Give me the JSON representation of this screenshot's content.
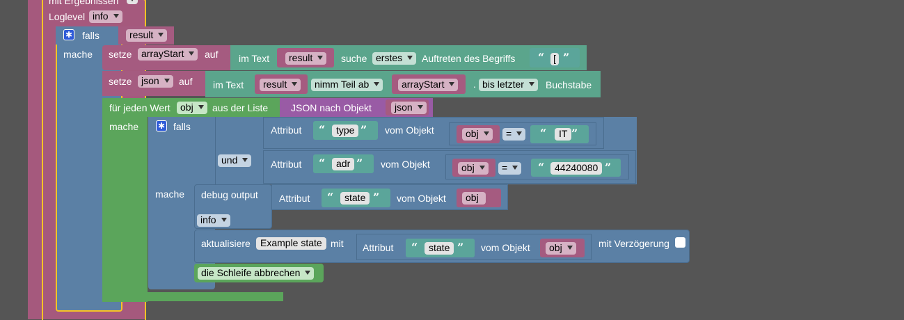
{
  "top": {
    "mit_ergebnissen_label": "mit Ergebnissen",
    "loglevel_label": "Loglevel",
    "loglevel_value": "info"
  },
  "outer_if": {
    "falls_label": "falls",
    "condition_var": "result",
    "mache_label": "mache"
  },
  "set_arraystart": {
    "setze_label": "setze",
    "var": "arrayStart",
    "auf_label": "auf",
    "im_text_label": "im Text",
    "text_var": "result",
    "suche_label": "suche",
    "mode": "erstes",
    "auftreten_label": "Auftreten des Begriffs",
    "search_term": "["
  },
  "set_json": {
    "setze_label": "setze",
    "var": "json",
    "auf_label": "auf",
    "im_text_label": "im Text",
    "text_var": "result",
    "nimm_label": "nimm Teil ab",
    "from_var": "arrayStart",
    "dot": ".",
    "to_mode": "bis letzter",
    "buchstabe_label": "Buchstabe"
  },
  "foreach": {
    "label": "für jeden Wert",
    "var": "obj",
    "aus_label": "aus der Liste",
    "json_nach_label": "JSON nach Objekt",
    "json_var": "json",
    "mache_label": "mache"
  },
  "inner_if": {
    "falls_label": "falls",
    "und_label": "und",
    "mache_label": "mache",
    "cond1": {
      "attribut_label": "Attribut",
      "attr": "type",
      "vom_objekt_label": "vom Objekt",
      "obj_var": "obj",
      "op": "=",
      "value": "IT"
    },
    "cond2": {
      "attribut_label": "Attribut",
      "attr": "adr",
      "vom_objekt_label": "vom Objekt",
      "obj_var": "obj",
      "op": "=",
      "value": "44240080"
    }
  },
  "debug": {
    "label": "debug output",
    "attribut_label": "Attribut",
    "attr": "state",
    "vom_objekt_label": "vom Objekt",
    "obj_var": "obj",
    "level": "info"
  },
  "update": {
    "label": "aktualisiere",
    "target": "Example state",
    "mit_label": "mit",
    "attribut_label": "Attribut",
    "attr": "state",
    "vom_objekt_label": "vom Objekt",
    "obj_var": "obj",
    "delay_label": "mit Verzögerung"
  },
  "break_loop": {
    "label": "die Schleife abbrechen"
  },
  "colors": {
    "workspace": "#555555",
    "selection_outline": "#f7c325",
    "logic": "#5b80a5",
    "variables": "#a55b80",
    "text": "#5ba58c",
    "loop": "#5ba55b",
    "convert": "#995ba5"
  }
}
